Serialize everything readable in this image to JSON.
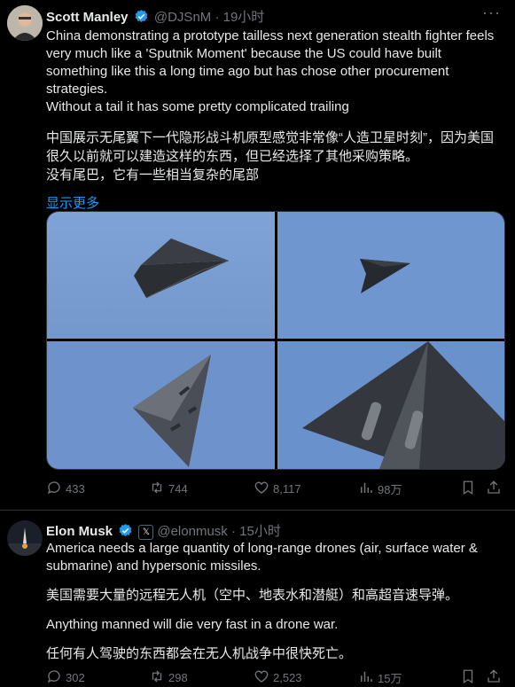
{
  "tweet1": {
    "name": "Scott Manley",
    "handle": "@DJSnM",
    "time": "· 19小时",
    "lines": [
      "China demonstrating a prototype tailless next generation stealth fighter feels very much like a 'Sputnik Moment' because the US could have built something like this a long time ago but has chose other procurement strategies.",
      "Without a tail it has some pretty complicated trailing",
      "中国展示无尾翼下一代隐形战斗机原型感觉非常像“人造卫星时刻”，因为美国很久以前就可以建造这样的东西，但已经选择了其他采购策略。",
      "没有尾巴，它有一些相当复杂的尾部"
    ],
    "show_more": "显示更多",
    "stats": {
      "replies": "433",
      "reposts": "744",
      "likes": "8,117",
      "views": "98万"
    }
  },
  "tweet2": {
    "name": "Elon Musk",
    "affiliate_badge": "𝕏",
    "handle": "@elonmusk",
    "time": "· 15小时",
    "para1": "America needs a large quantity of long-range drones (air, surface water & submarine) and hypersonic missiles.",
    "para2": "美国需要大量的远程无人机（空中、地表水和潜艇）和高超音速导弹。",
    "para3": "Anything manned will die very fast in a drone war.",
    "para4": "任何有人驾驶的东西都会在无人机战争中很快死亡。",
    "stats": {
      "replies": "302",
      "reposts": "298",
      "likes": "2,523",
      "views": "15万"
    }
  },
  "colors": {
    "accent": "#1d9bf0",
    "muted": "#71767b",
    "verified": "#1d9bf0",
    "sky": "#7a9fd4"
  },
  "icons": [
    "more-icon",
    "verified-icon",
    "reply-icon",
    "repost-icon",
    "like-icon",
    "views-icon",
    "bookmark-icon",
    "share-icon"
  ]
}
